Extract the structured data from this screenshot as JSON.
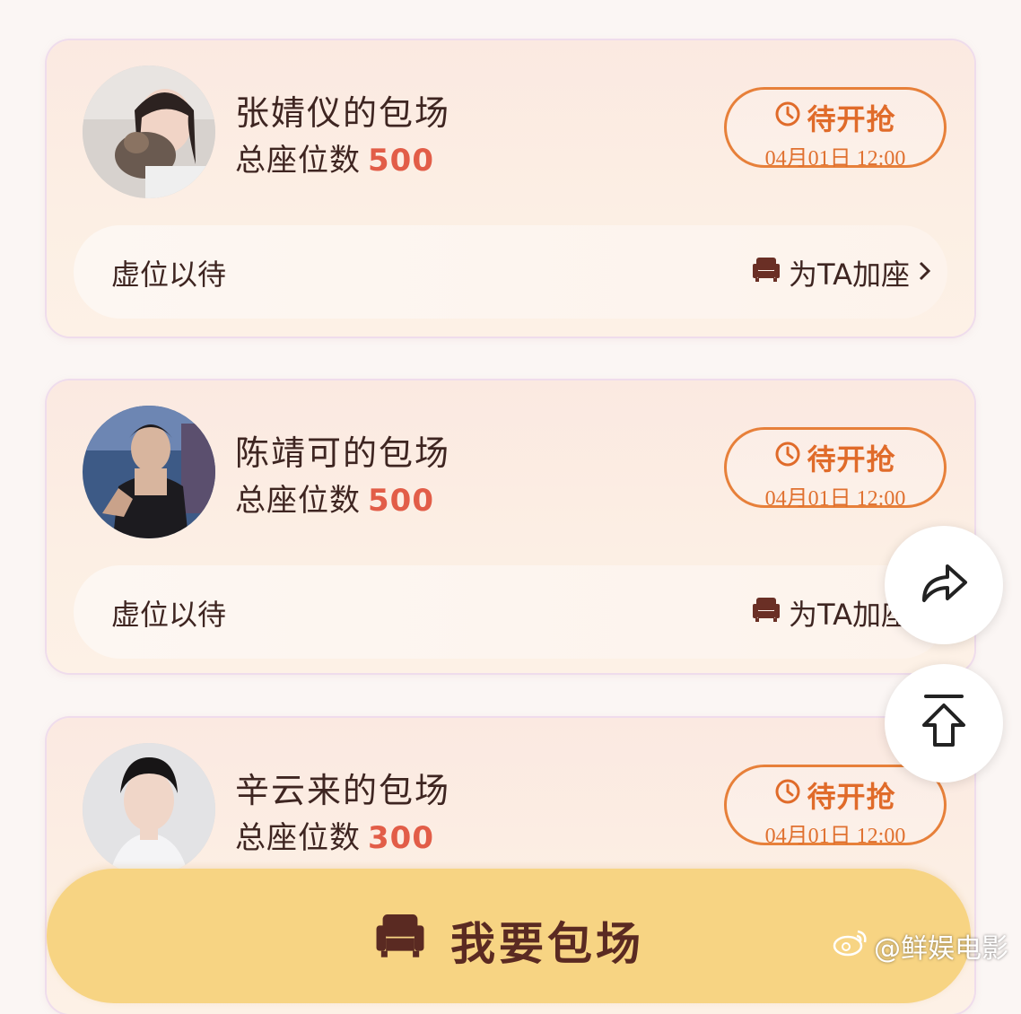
{
  "cards": [
    {
      "name": "张婧仪的包场",
      "seats_label": "总座位数",
      "seats": "500",
      "status": "待开抢",
      "time": "04月01日 12:00",
      "vacant": "虚位以待",
      "add_seat": "为TA加座"
    },
    {
      "name": "陈靖可的包场",
      "seats_label": "总座位数",
      "seats": "500",
      "status": "待开抢",
      "time": "04月01日 12:00",
      "vacant": "虚位以待",
      "add_seat": "为TA加座"
    },
    {
      "name": "辛云来的包场",
      "seats_label": "总座位数",
      "seats": "300",
      "status": "待开抢",
      "time": "04月01日 12:00"
    }
  ],
  "bottom_button": "我要包场",
  "watermark": "@鲜娱电影",
  "icons": {
    "clock": "clock-icon",
    "sofa": "sofa-icon",
    "chevron": "chevron-right-icon",
    "share": "share-icon",
    "top": "back-to-top-icon",
    "weibo": "weibo-icon"
  },
  "colors": {
    "accent": "#e7803a",
    "number": "#e25d48",
    "text": "#3e2521",
    "button": "#f7d483"
  }
}
